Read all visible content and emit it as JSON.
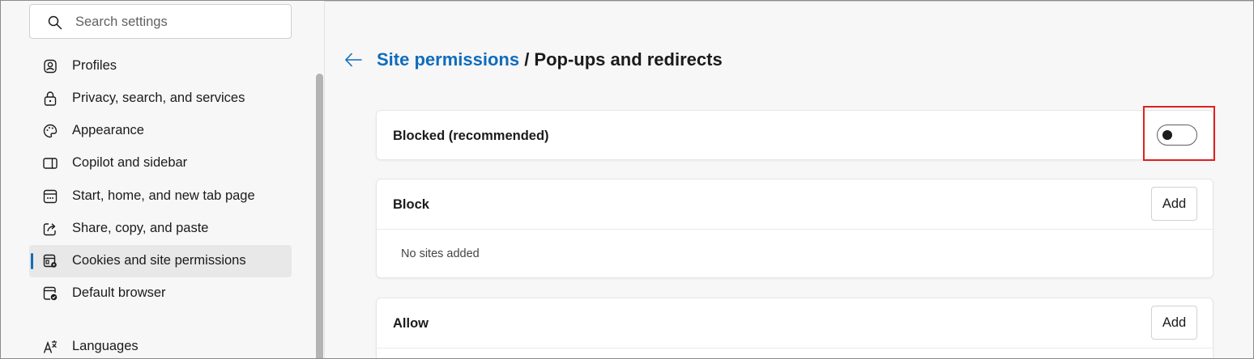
{
  "search": {
    "placeholder": "Search settings",
    "icon": "search-icon"
  },
  "sidebar": {
    "items": [
      {
        "label": "Profiles",
        "icon": "profile-icon"
      },
      {
        "label": "Privacy, search, and services",
        "icon": "lock-icon"
      },
      {
        "label": "Appearance",
        "icon": "palette-icon"
      },
      {
        "label": "Copilot and sidebar",
        "icon": "sidebar-icon"
      },
      {
        "label": "Start, home, and new tab page",
        "icon": "home-page-icon"
      },
      {
        "label": "Share, copy, and paste",
        "icon": "share-icon"
      },
      {
        "label": "Cookies and site permissions",
        "icon": "cookies-permissions-icon",
        "selected": true
      },
      {
        "label": "Default browser",
        "icon": "default-browser-icon"
      },
      {
        "label": "Languages",
        "icon": "languages-icon"
      }
    ]
  },
  "header": {
    "back_icon": "back-arrow-icon",
    "crumb_link": "Site permissions",
    "separator": " / ",
    "current": "Pop-ups and redirects"
  },
  "blocked_setting": {
    "label": "Blocked (recommended)",
    "toggle_on": false
  },
  "block_section": {
    "title": "Block",
    "add_label": "Add",
    "empty_text": "No sites added"
  },
  "allow_section": {
    "title": "Allow",
    "add_label": "Add"
  },
  "colors": {
    "accent": "#0f6cbd",
    "highlight": "#e02020",
    "selected_bg": "#e8e8e8"
  }
}
